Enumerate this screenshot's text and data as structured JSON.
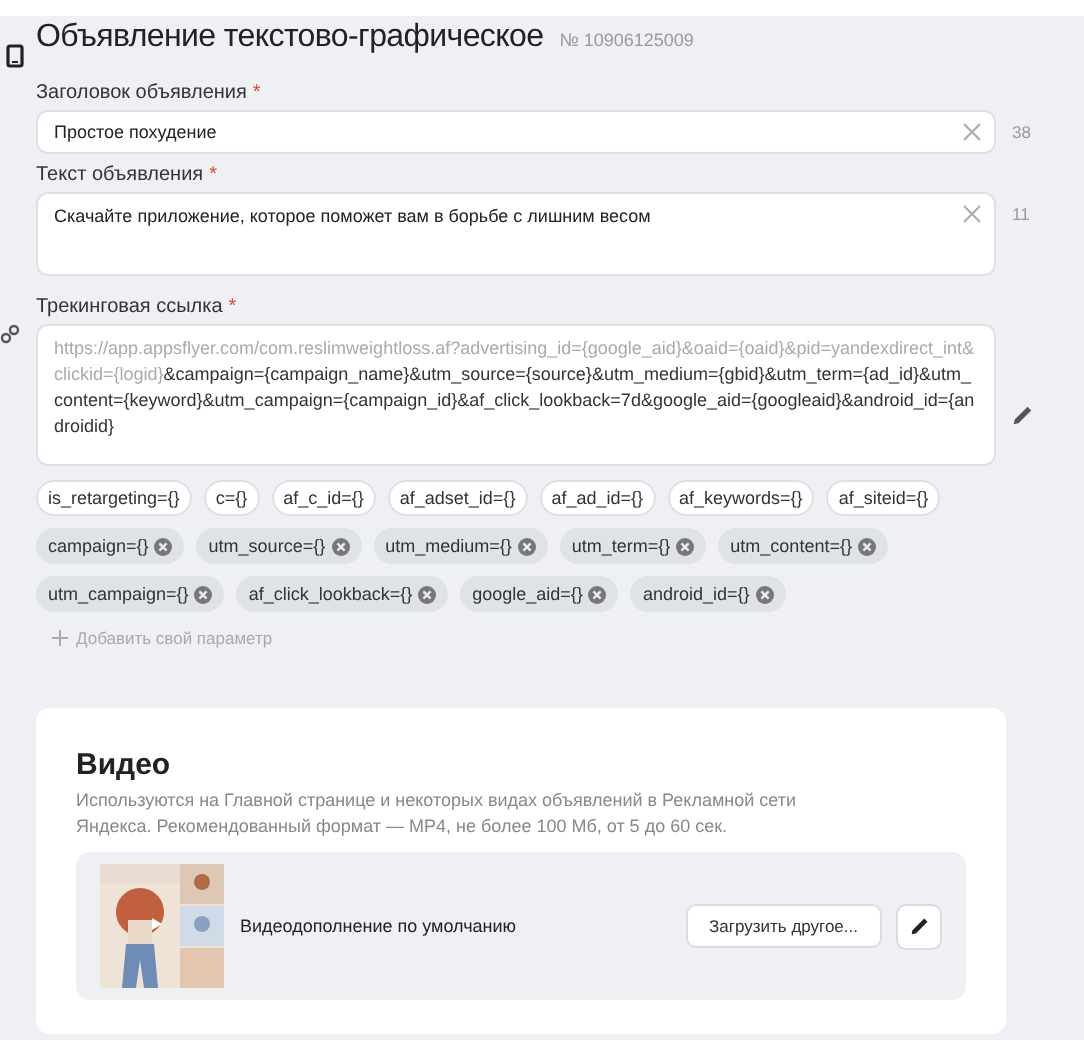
{
  "header": {
    "title": "Объявление текстово-графическое",
    "number": "№ 10906125009"
  },
  "fields": [
    {
      "label": "Заголовок объявления",
      "required_mark": "*",
      "value": "Простое похудение",
      "counter": "38",
      "multiline": false
    },
    {
      "label": "Текст объявления",
      "required_mark": "*",
      "value": "Скачайте приложение, которое поможет вам в борьбе с лишним весом",
      "counter": "11",
      "multiline": true
    }
  ],
  "tracking": {
    "label": "Трекинговая ссылка",
    "required_mark": "*",
    "base": "https://app.appsflyer.com/com.reslimweightloss.af?advertising_id={google_aid}&oaid={oaid}&pid=yandexdirect_int&clickid={logid}",
    "params": "&campaign={campaign_name}&utm_source={source}&utm_medium={gbid}&utm_term={ad_id}&utm_content={keyword}&utm_campaign={campaign_id}&af_click_lookback=7d&google_aid={googleaid}&android_id={androidid}"
  },
  "chips": [
    {
      "label": "is_retargeting={}",
      "added": false
    },
    {
      "label": "c={}",
      "added": false
    },
    {
      "label": "af_c_id={}",
      "added": false
    },
    {
      "label": "af_adset_id={}",
      "added": false
    },
    {
      "label": "af_ad_id={}",
      "added": false
    },
    {
      "label": "af_keywords={}",
      "added": false
    },
    {
      "label": "af_siteid={}",
      "added": false
    },
    {
      "label": "campaign={}",
      "added": true
    },
    {
      "label": "utm_source={}",
      "added": true
    },
    {
      "label": "utm_medium={}",
      "added": true
    },
    {
      "label": "utm_term={}",
      "added": true
    },
    {
      "label": "utm_content={}",
      "added": true
    },
    {
      "label": "utm_campaign={}",
      "added": true
    },
    {
      "label": "af_click_lookback={}",
      "added": true
    },
    {
      "label": "google_aid={}",
      "added": true
    },
    {
      "label": "android_id={}",
      "added": true
    }
  ],
  "add_param": "Добавить свой параметр",
  "video": {
    "title": "Видео",
    "description": "Используются на Главной странице и некоторых видах объявлений в Рекламной сети Яндекса. Рекомендованный формат — MP4, не более 100 Мб, от 5 до 60 сек.",
    "item_label": "Видеодополнение по умолчанию",
    "upload_button": "Загрузить другое..."
  }
}
